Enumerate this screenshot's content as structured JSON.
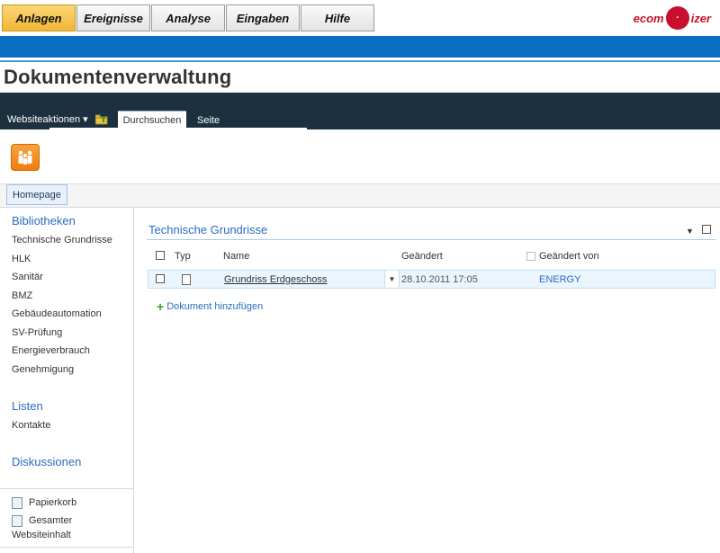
{
  "topnav": [
    "Anlagen",
    "Ereignisse",
    "Analyse",
    "Eingaben",
    "Hilfe"
  ],
  "logo": {
    "text": "ecom",
    "circle": "·",
    "suffix": "izer"
  },
  "page_title": "Dokumentenverwaltung",
  "ribbon": {
    "actions": "Websiteaktionen ▾",
    "tabs": [
      "Durchsuchen",
      "Seite"
    ]
  },
  "breadcrumb": "Homepage",
  "leftnav": {
    "libraries_head": "Bibliotheken",
    "libraries": [
      "Technische Grundrisse",
      "HLK",
      "Sanitär",
      "BMZ",
      "Gebäudeautomation",
      "SV-Prüfung",
      "Energieverbrauch",
      "Genehmigung"
    ],
    "lists_head": "Listen",
    "lists": [
      "Kontakte"
    ],
    "discussions_head": "Diskussionen",
    "recycle": "Papierkorb",
    "allcontent1": "Gesamter",
    "allcontent2": "Websiteinhalt"
  },
  "webpart": {
    "title": "Technische Grundrisse",
    "columns": {
      "type": "Typ",
      "name": "Name",
      "modified": "Geändert",
      "modified_by": "Geändert von"
    },
    "rows": [
      {
        "name": "Grundriss Erdgeschoss",
        "modified": "28.10.2011 17:05",
        "modified_by": "ENERGY"
      }
    ],
    "add": "Dokument hinzufügen"
  }
}
